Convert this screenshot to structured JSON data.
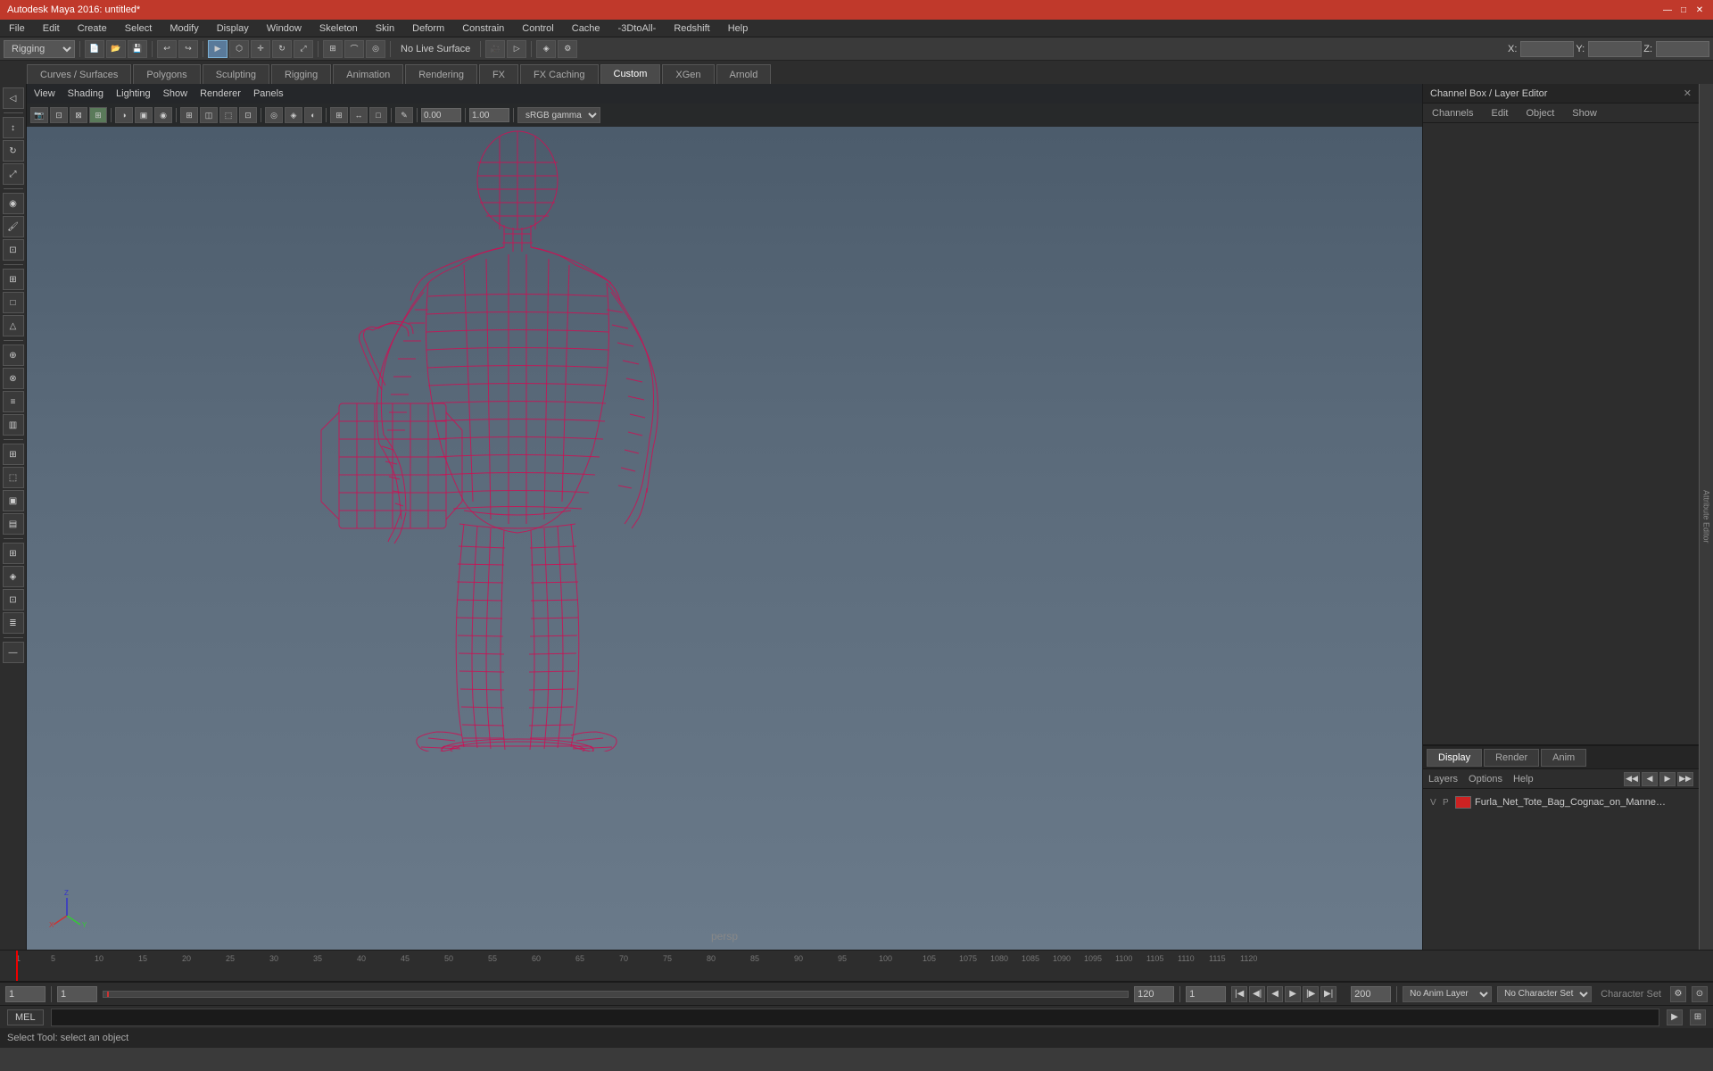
{
  "titleBar": {
    "title": "Autodesk Maya 2016: untitled*",
    "minimize": "—",
    "restore": "□",
    "close": "✕"
  },
  "menuBar": {
    "items": [
      "File",
      "Edit",
      "Create",
      "Select",
      "Modify",
      "Display",
      "Window",
      "Skeleton",
      "Skin",
      "Deform",
      "Constrain",
      "Control",
      "Cache",
      "-3DtoAll-",
      "Redshift",
      "Help"
    ]
  },
  "toolbar1": {
    "dropdown": "Rigging",
    "noLiveSurface": "No Live Surface",
    "xLabel": "X:",
    "yLabel": "Y:",
    "zLabel": "Z:"
  },
  "tabs": {
    "items": [
      "Curves / Surfaces",
      "Polygons",
      "Sculpting",
      "Rigging",
      "Animation",
      "Rendering",
      "FX",
      "FX Caching",
      "Custom",
      "XGen",
      "Arnold"
    ],
    "active": "Custom"
  },
  "viewport": {
    "menus": [
      "View",
      "Shading",
      "Lighting",
      "Show",
      "Renderer",
      "Panels"
    ],
    "label": "persp",
    "gamma": "sRGB gamma",
    "value1": "0.00",
    "value2": "1.00"
  },
  "channelBox": {
    "title": "Channel Box / Layer Editor",
    "tabs": [
      "Channels",
      "Edit",
      "Object",
      "Show"
    ]
  },
  "layerEditor": {
    "tabs": [
      "Display",
      "Render",
      "Anim"
    ],
    "activeTab": "Display",
    "menus": [
      "Layers",
      "Options",
      "Help"
    ],
    "layers": [
      {
        "vp": "V",
        "p": "P",
        "color": "#cc2222",
        "name": "Furla_Net_Tote_Bag_Cognac_on_Mannequin_mb_standa"
      }
    ]
  },
  "timeline": {
    "start": 1,
    "end": 120,
    "ticks": [
      "1",
      "5",
      "10",
      "15",
      "20",
      "25",
      "30",
      "35",
      "40",
      "45",
      "50",
      "55",
      "60",
      "65",
      "70",
      "75",
      "80",
      "85",
      "90",
      "95",
      "100",
      "105",
      "1075",
      "1080",
      "1085",
      "1090",
      "1095",
      "1100",
      "1105",
      "1110",
      "1115",
      "1120"
    ]
  },
  "bottomControls": {
    "currentFrame": "1",
    "startRange": "1",
    "endRange": "120",
    "animStart": "1",
    "animEnd": "200",
    "noAnimLayer": "No Anim Layer",
    "noCharSet": "No Character Set",
    "characterSet": "Character Set"
  },
  "statusBar": {
    "mel": "MEL",
    "statusText": "Select Tool: select an object"
  }
}
